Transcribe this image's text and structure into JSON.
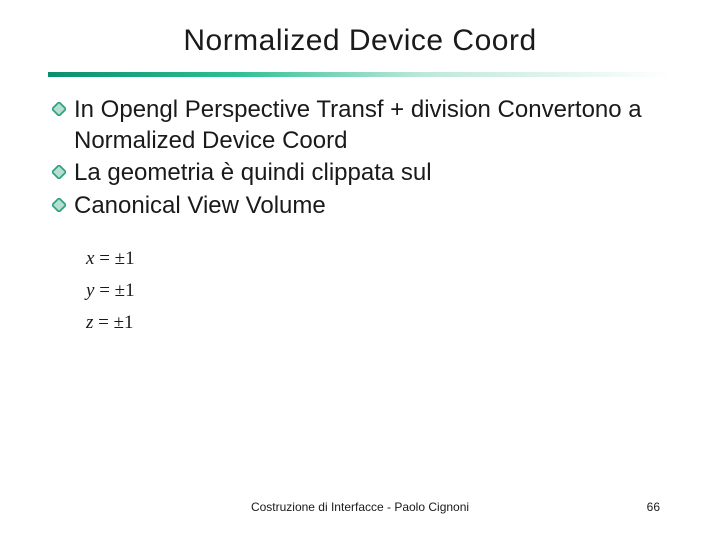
{
  "title": "Normalized Device Coord",
  "bullets": [
    "In Opengl Perspective Transf + division Convertono a Normalized Device Coord",
    "La geometria è quindi clippata sul",
    "Canonical View Volume"
  ],
  "formulas": {
    "x": "x = ±1",
    "y": "y = ±1",
    "z": "z = ±1"
  },
  "footer": "Costruzione di Interfacce - Paolo Cignoni",
  "page_number": "66"
}
